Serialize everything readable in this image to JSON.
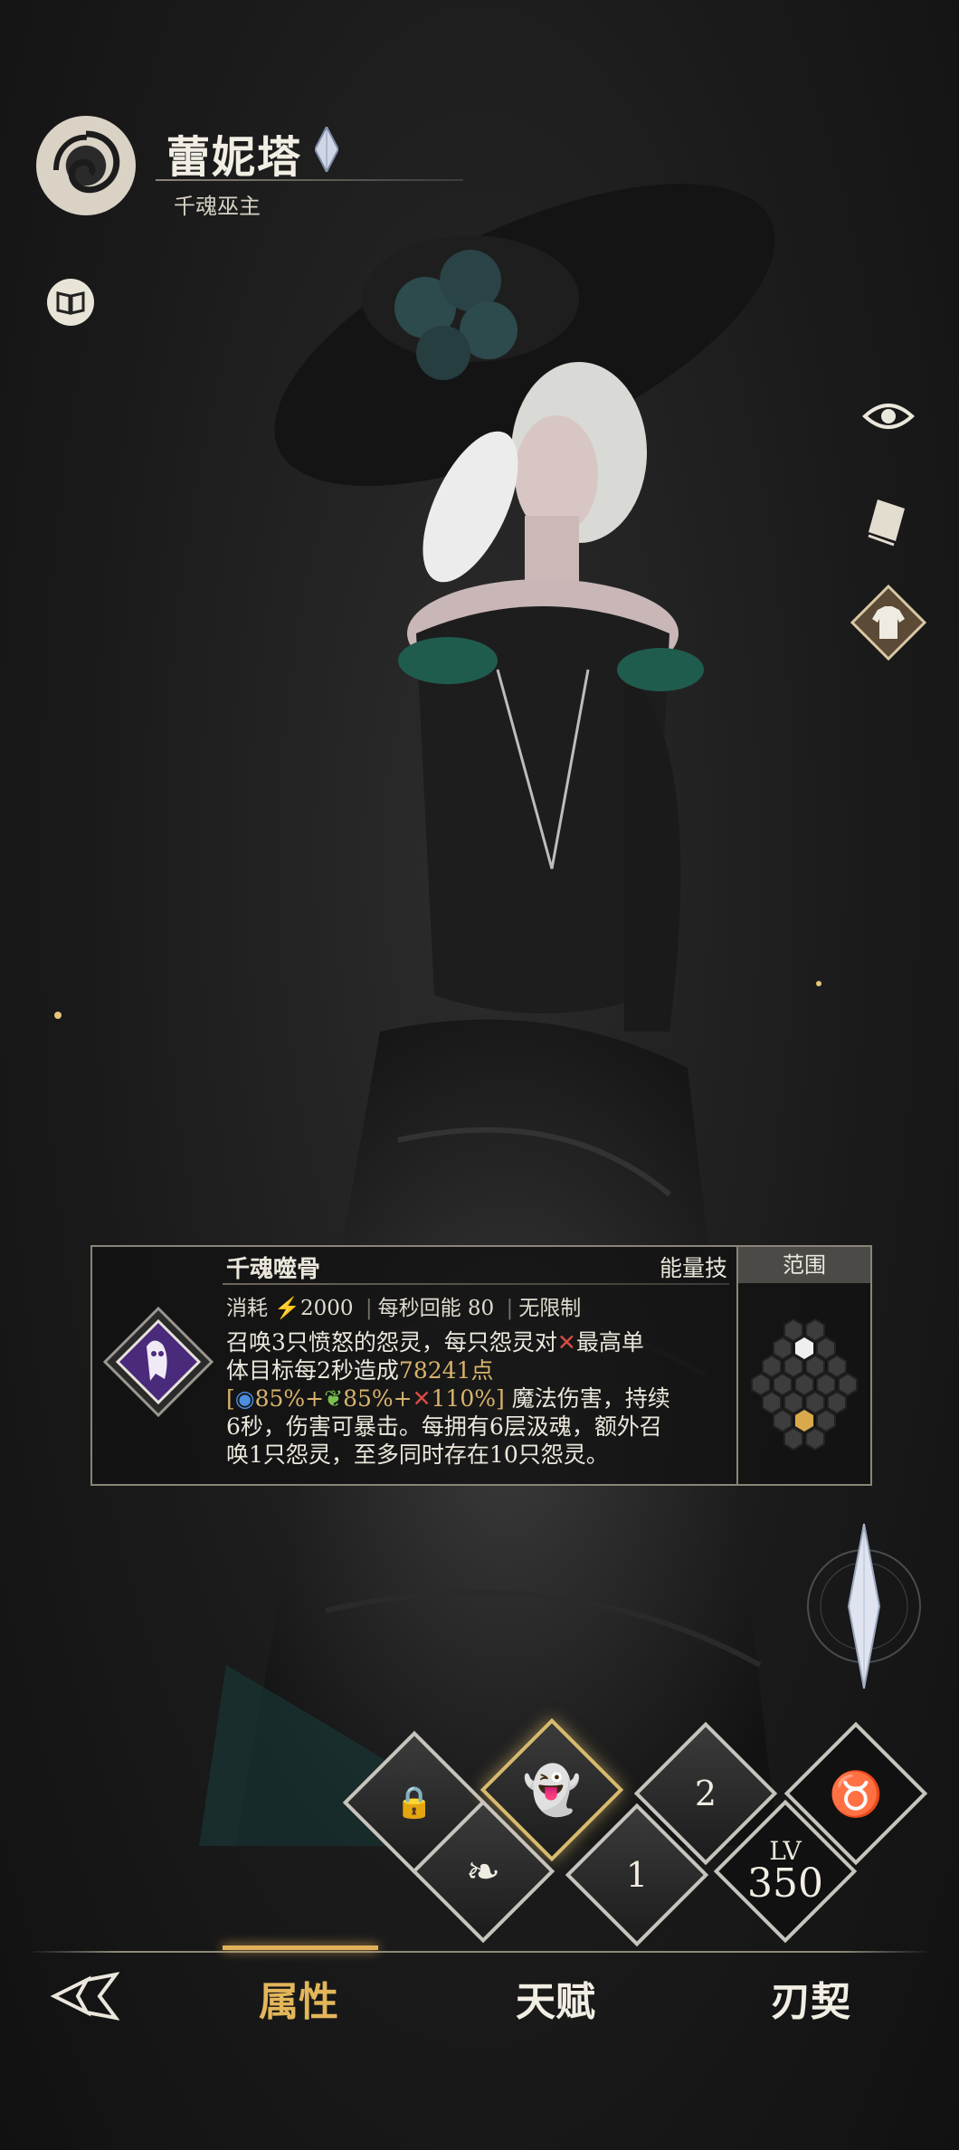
{
  "character": {
    "name": "蕾妮塔",
    "title": "千魂巫主"
  },
  "skill": {
    "name": "千魂噬骨",
    "type": "能量技",
    "cost_label": "消耗",
    "cost_value": "2000",
    "regen": "每秒回能 80",
    "limit": "无限制",
    "desc_line1_a": "召唤3只愤怒的怨灵，每只怨灵对",
    "desc_line1_b": "最高单",
    "desc_line2_a": "体目标每2秒造成",
    "damage_value": "78241点",
    "bracket_open": "[",
    "coef1": "85%+",
    "coef2": "85%+",
    "coef3": "110%",
    "bracket_close": "]",
    "desc_line3_tail": "魔法伤害，持续",
    "desc_line4": "6秒，伤害可暴击。每拥有6层汲魂，额外召",
    "desc_line5": "唤1只怨灵，至多同时存在10只怨灵。"
  },
  "range": {
    "label": "范围"
  },
  "skill_slots": {
    "slot2_number": "2",
    "slot1_number": "1",
    "level_label": "LV",
    "level_value": "350"
  },
  "nav": {
    "tabs": [
      "属性",
      "天赋",
      "刃契"
    ],
    "active_index": 0
  },
  "colors": {
    "accent_gold": "#e3b65a",
    "damage_gold": "#d9b46b",
    "target_red": "#d84b45"
  },
  "icons": {
    "emblem": "swirl-emblem-icon",
    "lore": "open-book-icon",
    "view": "eye-icon",
    "card": "card-icon",
    "outfit": "tshirt-icon",
    "back": "back-arrow-icon"
  }
}
